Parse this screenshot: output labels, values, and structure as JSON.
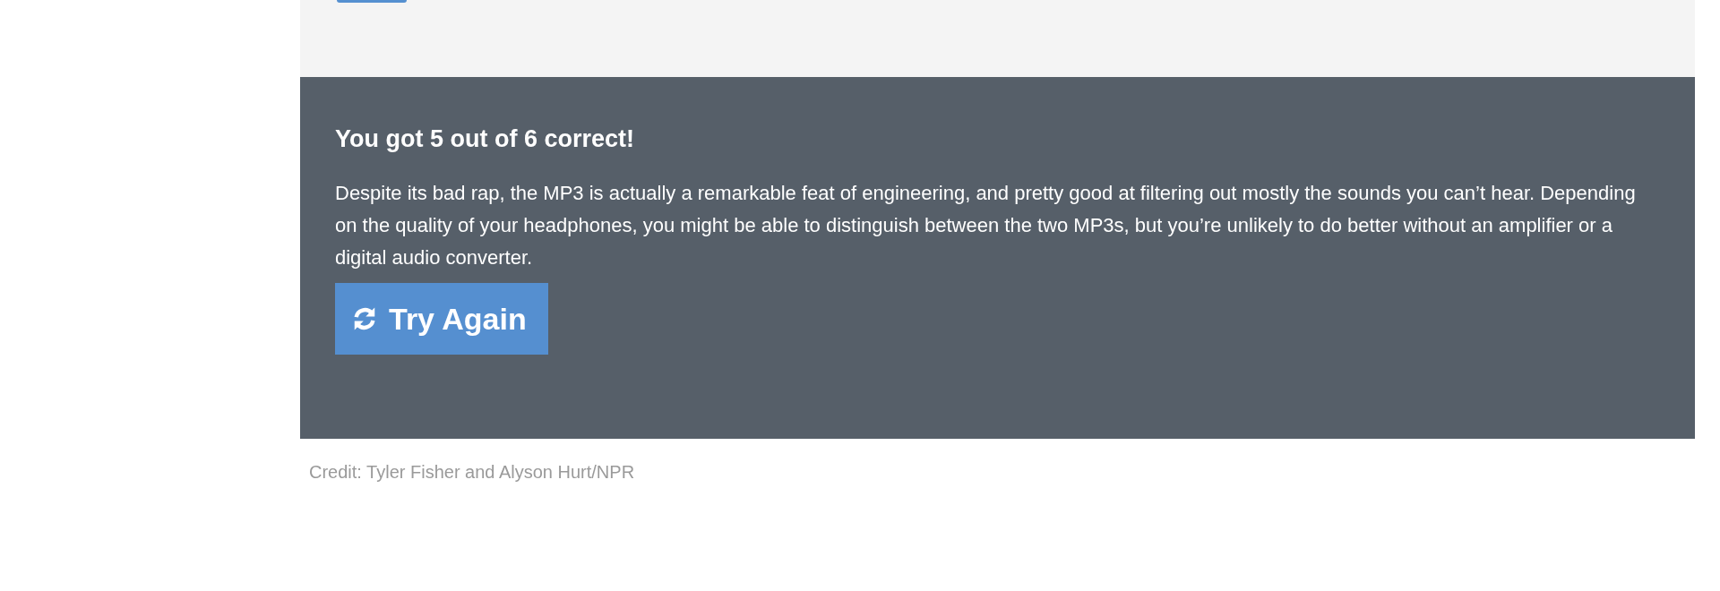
{
  "result": {
    "title": "You got 5 out of 6 correct!",
    "message": "Despite its bad rap, the MP3 is actually a remarkable feat of engineering, and pretty good at filtering out mostly the sounds you can’t hear. Depending on the quality of your headphones, you might be able to distinguish between the two MP3s, but you’re unlikely to do better without an amplifier or a digital audio converter.",
    "button": "Try Again"
  },
  "credit": "Credit: Tyler Fisher and Alyson Hurt/NPR"
}
